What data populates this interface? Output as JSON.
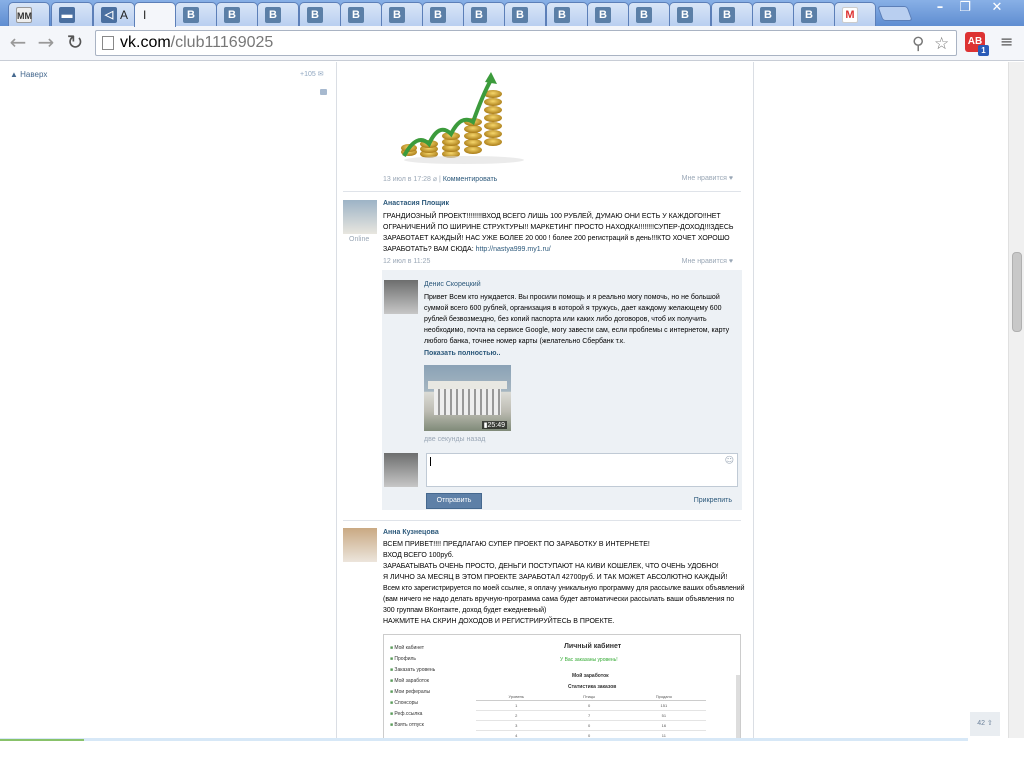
{
  "browser": {
    "tabs": [
      {
        "icon": "mm-icon",
        "label": ""
      },
      {
        "icon": "chat-icon",
        "label": ""
      },
      {
        "icon": "audio-icon",
        "label": "A"
      },
      {
        "icon": "",
        "label": "I"
      },
      {
        "icon": "vk-icon",
        "label": ""
      },
      {
        "icon": "vk-icon",
        "label": ""
      },
      {
        "icon": "vk-icon",
        "label": ""
      },
      {
        "icon": "vk-icon",
        "label": ""
      },
      {
        "icon": "vk-icon",
        "label": ""
      },
      {
        "icon": "vk-icon",
        "label": ""
      },
      {
        "icon": "vk-icon",
        "label": ""
      },
      {
        "icon": "vk-icon",
        "label": ""
      },
      {
        "icon": "vk-icon",
        "label": ""
      },
      {
        "icon": "vk-icon",
        "label": ""
      },
      {
        "icon": "vk-icon",
        "label": ""
      },
      {
        "icon": "vk-icon",
        "label": ""
      },
      {
        "icon": "vk-icon",
        "label": ""
      },
      {
        "icon": "vk-icon",
        "label": ""
      },
      {
        "icon": "vk-icon",
        "label": ""
      },
      {
        "icon": "vk-icon",
        "label": ""
      },
      {
        "icon": "gmail-icon",
        "label": ""
      }
    ],
    "url_host": "vk.com",
    "url_path": "/club11169025",
    "extension_badge": "1"
  },
  "left": {
    "to_top": "Наверх",
    "counter": "+105"
  },
  "post1": {
    "date": "13 июл в 17:28",
    "comment_link": "Комментировать",
    "like": "Мне нравится"
  },
  "post2": {
    "author": "Анастасия Площик",
    "status": "Online",
    "text": [
      "ГРАНДИОЗНЫЙ ПРОЕКТ!!!!!!!!ВХОД ВСЕГО ЛИШЬ 100 РУБЛЕЙ, ДУМАЮ ОНИ ЕСТЬ У КАЖДОГО!!НЕТ",
      "ОГРАНИЧЕНИЙ ПО ШИРИНЕ СТРУКТУРЫ!! МАРКЕТИНГ ПРОСТО НАХОДКА!!!!!!!!СУПЕР-ДОХОД!!!ЗДЕСЬ",
      "ЗАРАБОТАЕТ КАЖДЫЙ! НАС УЖЕ БОЛЕЕ 20 000 ! более 200 регистраций в день!!!КТО ХОЧЕТ ХОРОШО",
      "ЗАРАБОТАТЬ? ВАМ СЮДА:"
    ],
    "link": "http://nastya999.my1.ru/",
    "date": "12 июл в 11:25",
    "like": "Мне нравится"
  },
  "reply": {
    "author": "Денис Скорецкий",
    "text": [
      "Привет Всем кто нуждается. Вы просили помощь и я реально могу помочь, но не большой",
      "суммой всего 600 рублей, организация в которой я тружусь, дает каждому желающему 600",
      "рублей безвозмездно, без копий паспорта или каких либо договоров, чтоб их получить",
      "необходимо, почта на сервисе Google, могу завести сам, если проблемы с интернетом, карту",
      "любого банка, точнее номер карты (желательно Сбербанк т.к."
    ],
    "show_more": "Показать полностью..",
    "video_duration": "25:49",
    "time": "две секунды назад",
    "send": "Отправить",
    "attach": "Прикрепить"
  },
  "post3": {
    "author": "Анна Кузнецова",
    "text": [
      "ВСЕМ ПРИВЕТ!!!! ПРЕДЛАГАЮ СУПЕР ПРОЕКТ ПО ЗАРАБОТКУ В ИНТЕРНЕТЕ!",
      "ВХОД ВСЕГО 100руб.",
      "ЗАРАБАТЫВАТЬ ОЧЕНЬ ПРОСТО, ДЕНЬГИ ПОСТУПАЮТ НА КИВИ КОШЕЛЕК, ЧТО ОЧЕНЬ УДОБНО!",
      "Я ЛИЧНО ЗА МЕСЯЦ В ЭТОМ ПРОЕКТЕ ЗАРАБОТАЛ 42700руб. И ТАК МОЖЕТ АБСОЛЮТНО КАЖДЫЙ!",
      "Всем кто зарегистрируется по моей ссылке, я оплачу уникальную программу для рассылке ваших объявлений",
      "(вам ничего не надо делать вручную-программа сама будет автоматически рассылать ваши объявления по",
      "300 группам ВКонтакте, доход будет ежедневный)",
      "НАЖМИТЕ НА СКРИН ДОХОДОВ И РЕГИСТРИРУЙТЕСЬ В ПРОЕКТЕ."
    ]
  },
  "cabinet": {
    "title": "Личный кабинет",
    "subtitle": "У Вас заказаны уровень!",
    "earnings": "Мой заработок",
    "stats": "Статистика заказов",
    "menu": [
      "Мой кабинет",
      "Профиль",
      "Заказать уровень",
      "Мой заработок",
      "Мои рефералы",
      "Спонсоры",
      "Реф.ссылка",
      "Взять отпуск"
    ],
    "cols": [
      "Уровень",
      "Птицы",
      "Продано"
    ],
    "rows": [
      [
        "1",
        "0",
        "151"
      ],
      [
        "2",
        "7",
        "51"
      ],
      [
        "3",
        "0",
        "16"
      ],
      [
        "4",
        "0",
        "11"
      ]
    ]
  },
  "counter_badge": "42"
}
